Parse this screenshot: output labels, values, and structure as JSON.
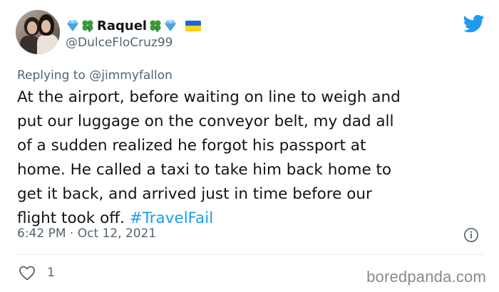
{
  "author": {
    "display_name": "Raquel",
    "handle": "@DulceFloCruz99",
    "name_emojis": [
      "gem-icon",
      "four-leaf-clover-icon",
      "four-leaf-clover-icon",
      "gem-icon",
      "ukraine-flag-icon"
    ]
  },
  "reply": {
    "prefix": "Replying to",
    "mention": "@jimmyfallon"
  },
  "tweet": {
    "lines": [
      "At the airport, before waiting on line to weigh and",
      "put our luggage on the conveyor belt, my dad all",
      "of a sudden realized he forgot his passport at",
      "home. He called a taxi to take him back home to",
      "get it back, and arrived just in time before our"
    ],
    "last_line_text": "flight took off.",
    "hashtag": "#TravelFail"
  },
  "meta": {
    "time": "6:42 PM",
    "separator": "·",
    "date": "Oct 12, 2021"
  },
  "engagement": {
    "likes": "1"
  },
  "watermark": "boredpanda.com",
  "colors": {
    "twitter_blue": "#1d9bf0",
    "text": "#0f1419",
    "secondary": "#536471"
  },
  "icons": {
    "brand": "twitter-bird-icon",
    "info": "info-icon",
    "like": "heart-icon"
  }
}
